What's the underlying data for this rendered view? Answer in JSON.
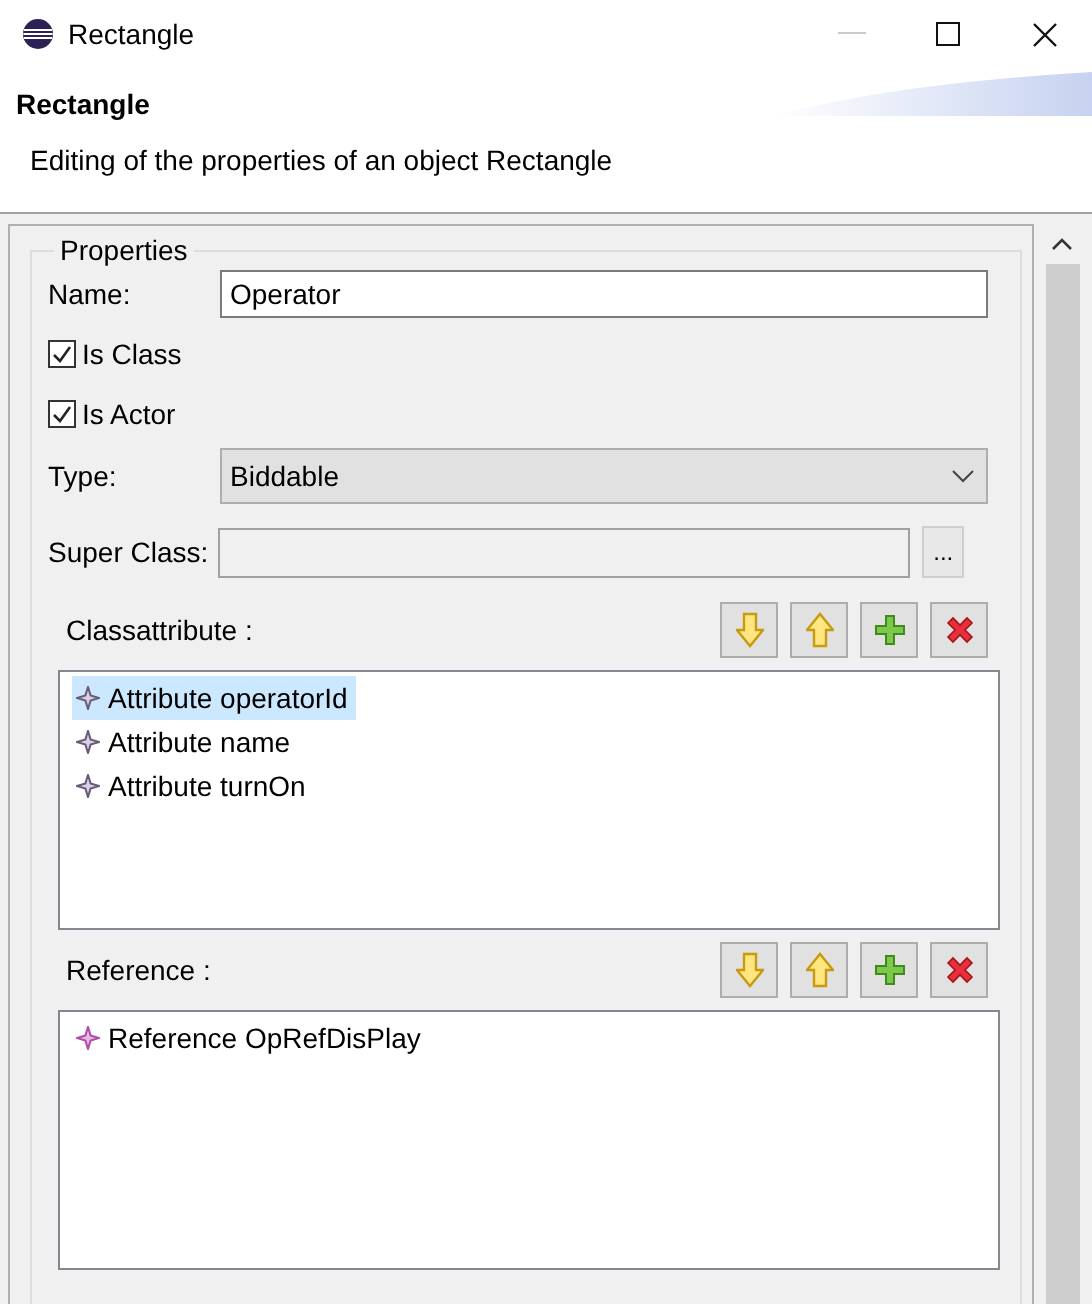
{
  "window": {
    "title": "Rectangle"
  },
  "header": {
    "title": "Rectangle",
    "description": "Editing of the properties of an object Rectangle"
  },
  "properties": {
    "legend": "Properties",
    "name_label": "Name:",
    "name_value": "Operator",
    "checkboxes": [
      {
        "label": "Is Class",
        "checked": true
      },
      {
        "label": "Is Actor",
        "checked": true
      }
    ],
    "type_label": "Type:",
    "type_value": "Biddable",
    "super_class_label": "Super Class:",
    "browse_button": "...",
    "sections": [
      {
        "label": "Classattribute :",
        "kind": "attribute",
        "buttons": [
          {
            "kind": "down"
          },
          {
            "kind": "up"
          },
          {
            "kind": "add"
          },
          {
            "kind": "remove"
          }
        ],
        "items": [
          {
            "label": "Attribute operatorId",
            "selected": true
          },
          {
            "label": "Attribute name",
            "selected": false
          },
          {
            "label": "Attribute turnOn",
            "selected": false
          }
        ]
      },
      {
        "label": "Reference :",
        "kind": "reference",
        "buttons": [
          {
            "kind": "down"
          },
          {
            "kind": "up"
          },
          {
            "kind": "add"
          },
          {
            "kind": "remove"
          }
        ],
        "items": [
          {
            "label": "Reference OpRefDisPlay",
            "selected": false
          }
        ]
      }
    ]
  }
}
